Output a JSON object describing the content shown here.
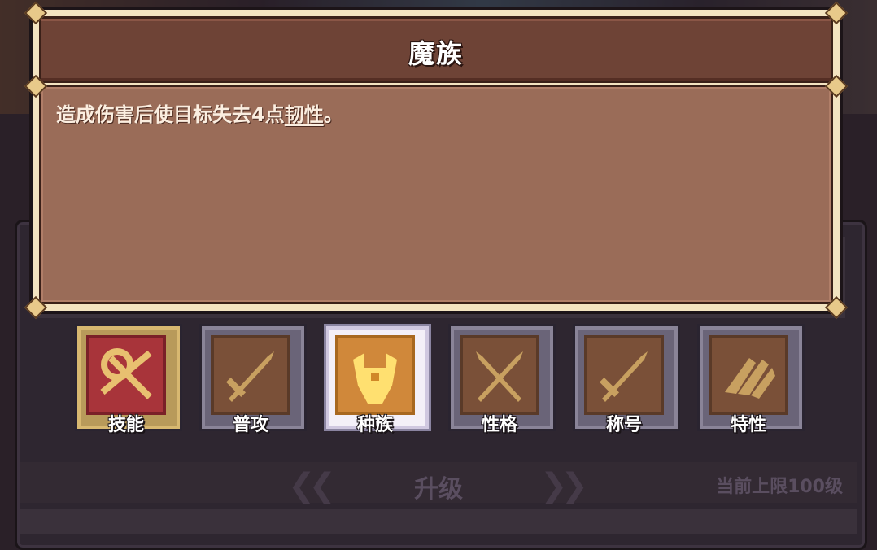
{
  "tooltip": {
    "title": "魔族",
    "description_prefix": "造成伤害后使目标失去4点",
    "description_keyword": "韧性",
    "description_suffix": "。"
  },
  "tabs": [
    {
      "id": "skill",
      "label": "技能",
      "icon": "skill-icon",
      "state": "special"
    },
    {
      "id": "attack",
      "label": "普攻",
      "icon": "sword-icon",
      "state": "normal"
    },
    {
      "id": "race",
      "label": "种族",
      "icon": "race-crest-icon",
      "state": "selected"
    },
    {
      "id": "personality",
      "label": "性格",
      "icon": "crossed-swords-icon",
      "state": "normal"
    },
    {
      "id": "title",
      "label": "称号",
      "icon": "sword-icon",
      "state": "normal"
    },
    {
      "id": "trait",
      "label": "特性",
      "icon": "wings-icon",
      "state": "normal"
    }
  ],
  "upgrade": {
    "title": "升级",
    "limit_text": "当前上限100级"
  },
  "colors": {
    "title_bar": "#6e4336",
    "body": "#9a6c58",
    "selected_tab": "#d0883a",
    "skill_tab": "#a8343a"
  }
}
